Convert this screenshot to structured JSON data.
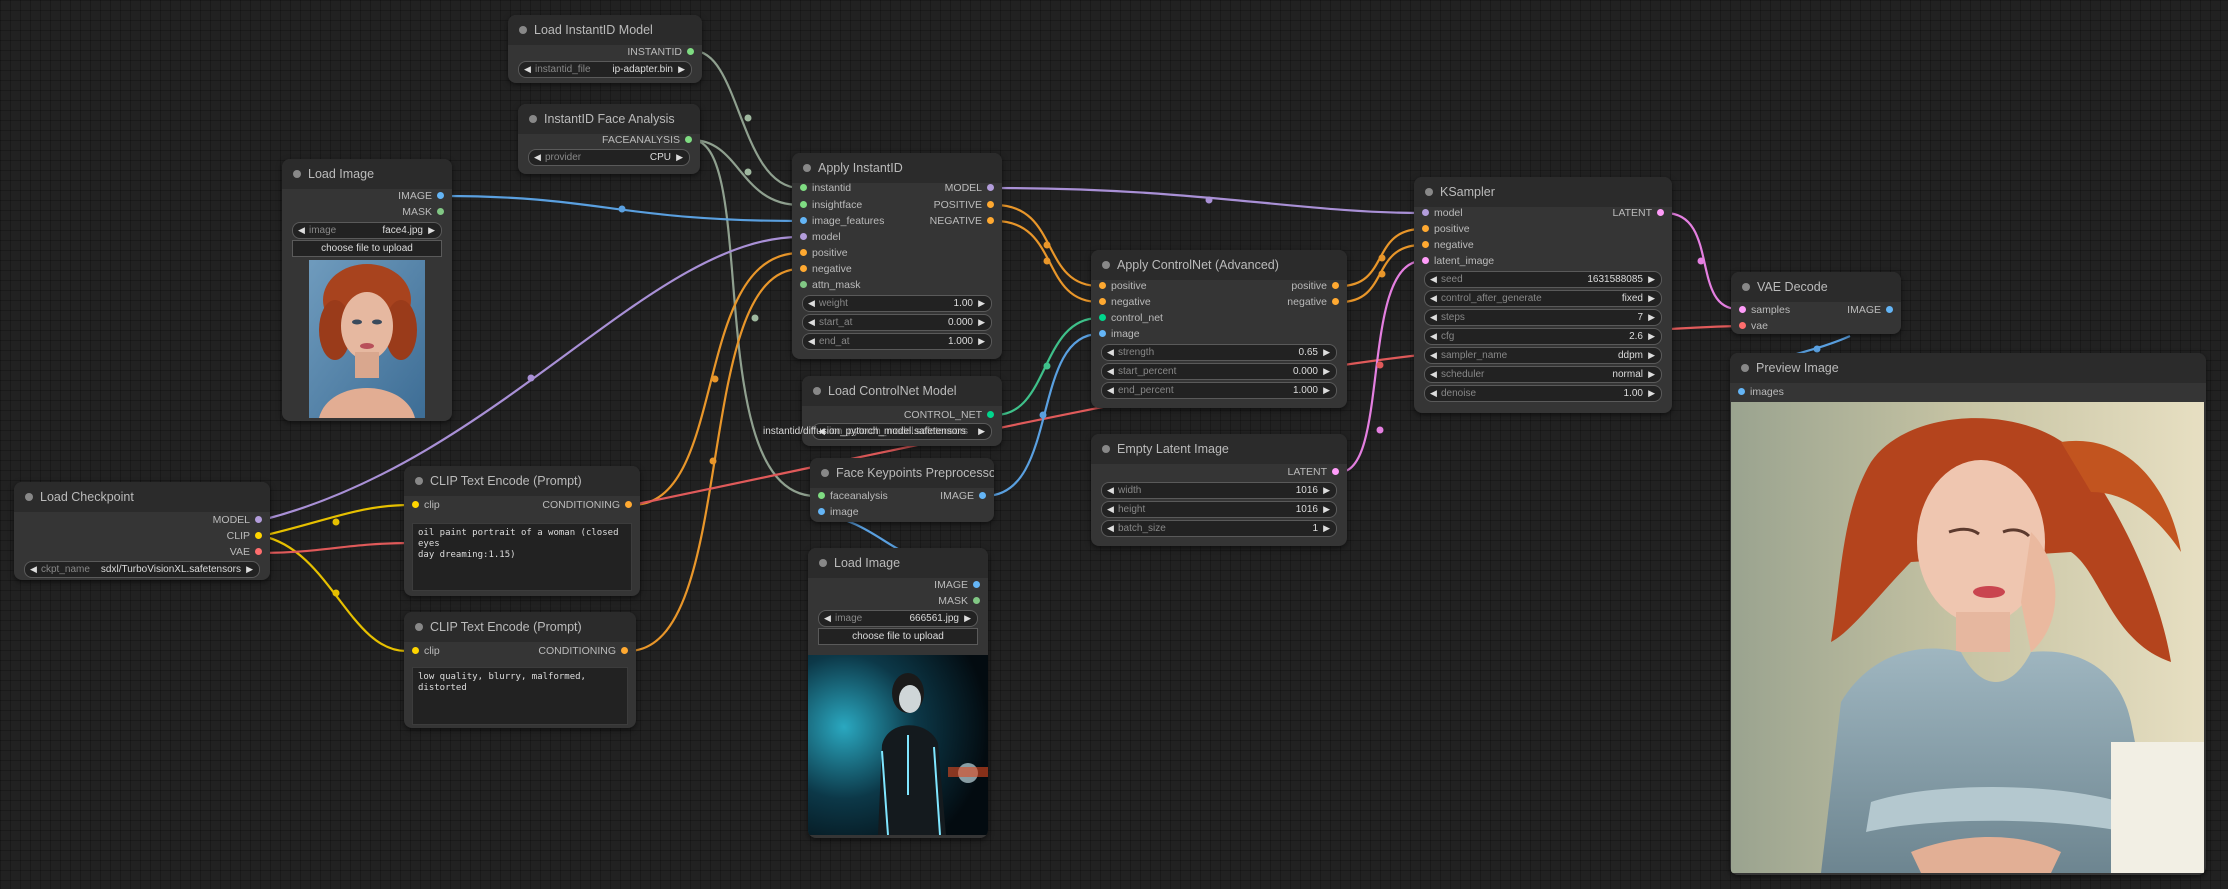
{
  "nodes": {
    "load_instantid": {
      "title": "Load InstantID Model",
      "out_instantid": "INSTANTID",
      "widget_label": "instantid_file",
      "widget_value": "ip-adapter.bin"
    },
    "instantid_face": {
      "title": "InstantID Face Analysis",
      "out_faceanalysis": "FACEANALYSIS",
      "widget_label": "provider",
      "widget_value": "CPU"
    },
    "load_image_1": {
      "title": "Load Image",
      "out_image": "IMAGE",
      "out_mask": "MASK",
      "widget_label": "image",
      "widget_value": "face4.jpg",
      "upload_label": "choose file to upload"
    },
    "apply_instantid": {
      "title": "Apply InstantID",
      "in_instantid": "instantid",
      "in_insightface": "insightface",
      "in_image_features": "image_features",
      "in_model": "model",
      "in_positive": "positive",
      "in_negative": "negative",
      "in_attn_mask": "attn_mask",
      "out_model": "MODEL",
      "out_positive": "POSITIVE",
      "out_negative": "NEGATIVE",
      "weight_label": "weight",
      "weight_value": "1.00",
      "start_label": "start_at",
      "start_value": "0.000",
      "end_label": "end_at",
      "end_value": "1.000"
    },
    "load_checkpoint": {
      "title": "Load Checkpoint",
      "out_model": "MODEL",
      "out_clip": "CLIP",
      "out_vae": "VAE",
      "widget_label": "ckpt_name",
      "widget_value": "sdxl/TurboVisionXL.safetensors"
    },
    "clip_pos": {
      "title": "CLIP Text Encode (Prompt)",
      "in_clip": "clip",
      "out_cond": "CONDITIONING",
      "text": "oil paint portrait of a woman (closed eyes\nday dreaming:1.15)"
    },
    "clip_neg": {
      "title": "CLIP Text Encode (Prompt)",
      "in_clip": "clip",
      "out_cond": "CONDITIONING",
      "text": "low quality, blurry, malformed, distorted"
    },
    "load_controlnet": {
      "title": "Load ControlNet Model",
      "out_cnet": "CONTROL_NET",
      "widget_label": "ion_pytorch_model.safetensors",
      "overflow_text": "instantid/diffusion_pytorch_model.safetensors"
    },
    "face_keypoints": {
      "title": "Face Keypoints Preprocessor",
      "in_faceanalysis": "faceanalysis",
      "in_image": "image",
      "out_image": "IMAGE"
    },
    "load_image_2": {
      "title": "Load Image",
      "out_image": "IMAGE",
      "out_mask": "MASK",
      "widget_label": "image",
      "widget_value": "666561.jpg",
      "upload_label": "choose file to upload"
    },
    "apply_controlnet": {
      "title": "Apply ControlNet (Advanced)",
      "in_positive": "positive",
      "in_negative": "negative",
      "in_control_net": "control_net",
      "in_image": "image",
      "out_positive": "positive",
      "out_negative": "negative",
      "strength_label": "strength",
      "strength_value": "0.65",
      "start_label": "start_percent",
      "start_value": "0.000",
      "end_label": "end_percent",
      "end_value": "1.000"
    },
    "empty_latent": {
      "title": "Empty Latent Image",
      "out_latent": "LATENT",
      "width_label": "width",
      "width_value": "1016",
      "height_label": "height",
      "height_value": "1016",
      "batch_label": "batch_size",
      "batch_value": "1"
    },
    "ksampler": {
      "title": "KSampler",
      "in_model": "model",
      "in_positive": "positive",
      "in_negative": "negative",
      "in_latent": "latent_image",
      "out_latent": "LATENT",
      "seed_label": "seed",
      "seed_value": "1631588085",
      "cag_label": "control_after_generate",
      "cag_value": "fixed",
      "steps_label": "steps",
      "steps_value": "7",
      "cfg_label": "cfg",
      "cfg_value": "2.6",
      "sampler_label": "sampler_name",
      "sampler_value": "ddpm",
      "scheduler_label": "scheduler",
      "scheduler_value": "normal",
      "denoise_label": "denoise",
      "denoise_value": "1.00"
    },
    "vae_decode": {
      "title": "VAE Decode",
      "in_samples": "samples",
      "in_vae": "vae",
      "out_image": "IMAGE"
    },
    "preview": {
      "title": "Preview Image",
      "in_images": "images"
    }
  },
  "colors": {
    "model": "#b39ddb",
    "clip": "#ffd500",
    "vae": "#ff6e6e",
    "image": "#64b5f6",
    "conditioning": "#ffa931",
    "latent": "#ff9cf9",
    "instantid": "#7fdc82",
    "control_net": "#00d78d"
  }
}
